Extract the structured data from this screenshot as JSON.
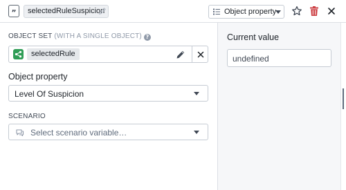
{
  "header": {
    "variable_name": "selectedRuleSuspicion",
    "type_select_label": "Object property",
    "icons": {
      "variable": "quote-badge-icon",
      "rename": "pencil-icon",
      "type": "list-icon",
      "favorite": "star-icon",
      "delete": "trash-icon",
      "close": "close-icon"
    },
    "delete_color": "#cd4246"
  },
  "object_set": {
    "label": "OBJECT SET",
    "label_muted": "(WITH A SINGLE OBJECT)",
    "help_glyph": "?",
    "value": "selectedRule",
    "icon": "object-set-icon",
    "icon_color": "#2f9d56"
  },
  "object_property": {
    "label": "Object property",
    "value": "Level Of Suspicion"
  },
  "scenario": {
    "label": "SCENARIO",
    "placeholder": "Select scenario variable…",
    "icon": "scenario-icon"
  },
  "current_value": {
    "label": "Current value",
    "value": "undefined"
  }
}
